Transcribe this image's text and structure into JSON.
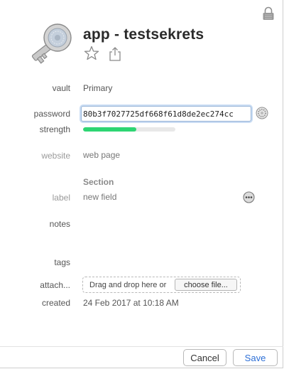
{
  "item": {
    "title": "app - testsekrets"
  },
  "fields": {
    "vault": {
      "label": "vault",
      "value": "Primary"
    },
    "password": {
      "label": "password",
      "value": "80b3f7027725df668f61d8de2ec274cc"
    },
    "strength": {
      "label": "strength",
      "level": 0.58,
      "color": "#2ed573"
    },
    "website": {
      "label": "website",
      "placeholder": "web page"
    },
    "section": {
      "title": "Section"
    },
    "custom": {
      "label": "label",
      "placeholder": "new field"
    },
    "notes": {
      "label": "notes"
    },
    "tags": {
      "label": "tags"
    },
    "attachments": {
      "label": "attach...",
      "drop_text": "Drag and drop here or",
      "choose_label": "choose file..."
    },
    "created": {
      "label": "created",
      "value": "24 Feb 2017 at 10:18 AM"
    }
  },
  "footer": {
    "cancel_label": "Cancel",
    "save_label": "Save"
  },
  "colors": {
    "accent": "#2d6fd6",
    "strength": "#2ed573"
  },
  "icons": [
    "lock-icon",
    "key-icon",
    "star-icon",
    "share-icon",
    "password-generator-icon",
    "more-options-icon"
  ]
}
